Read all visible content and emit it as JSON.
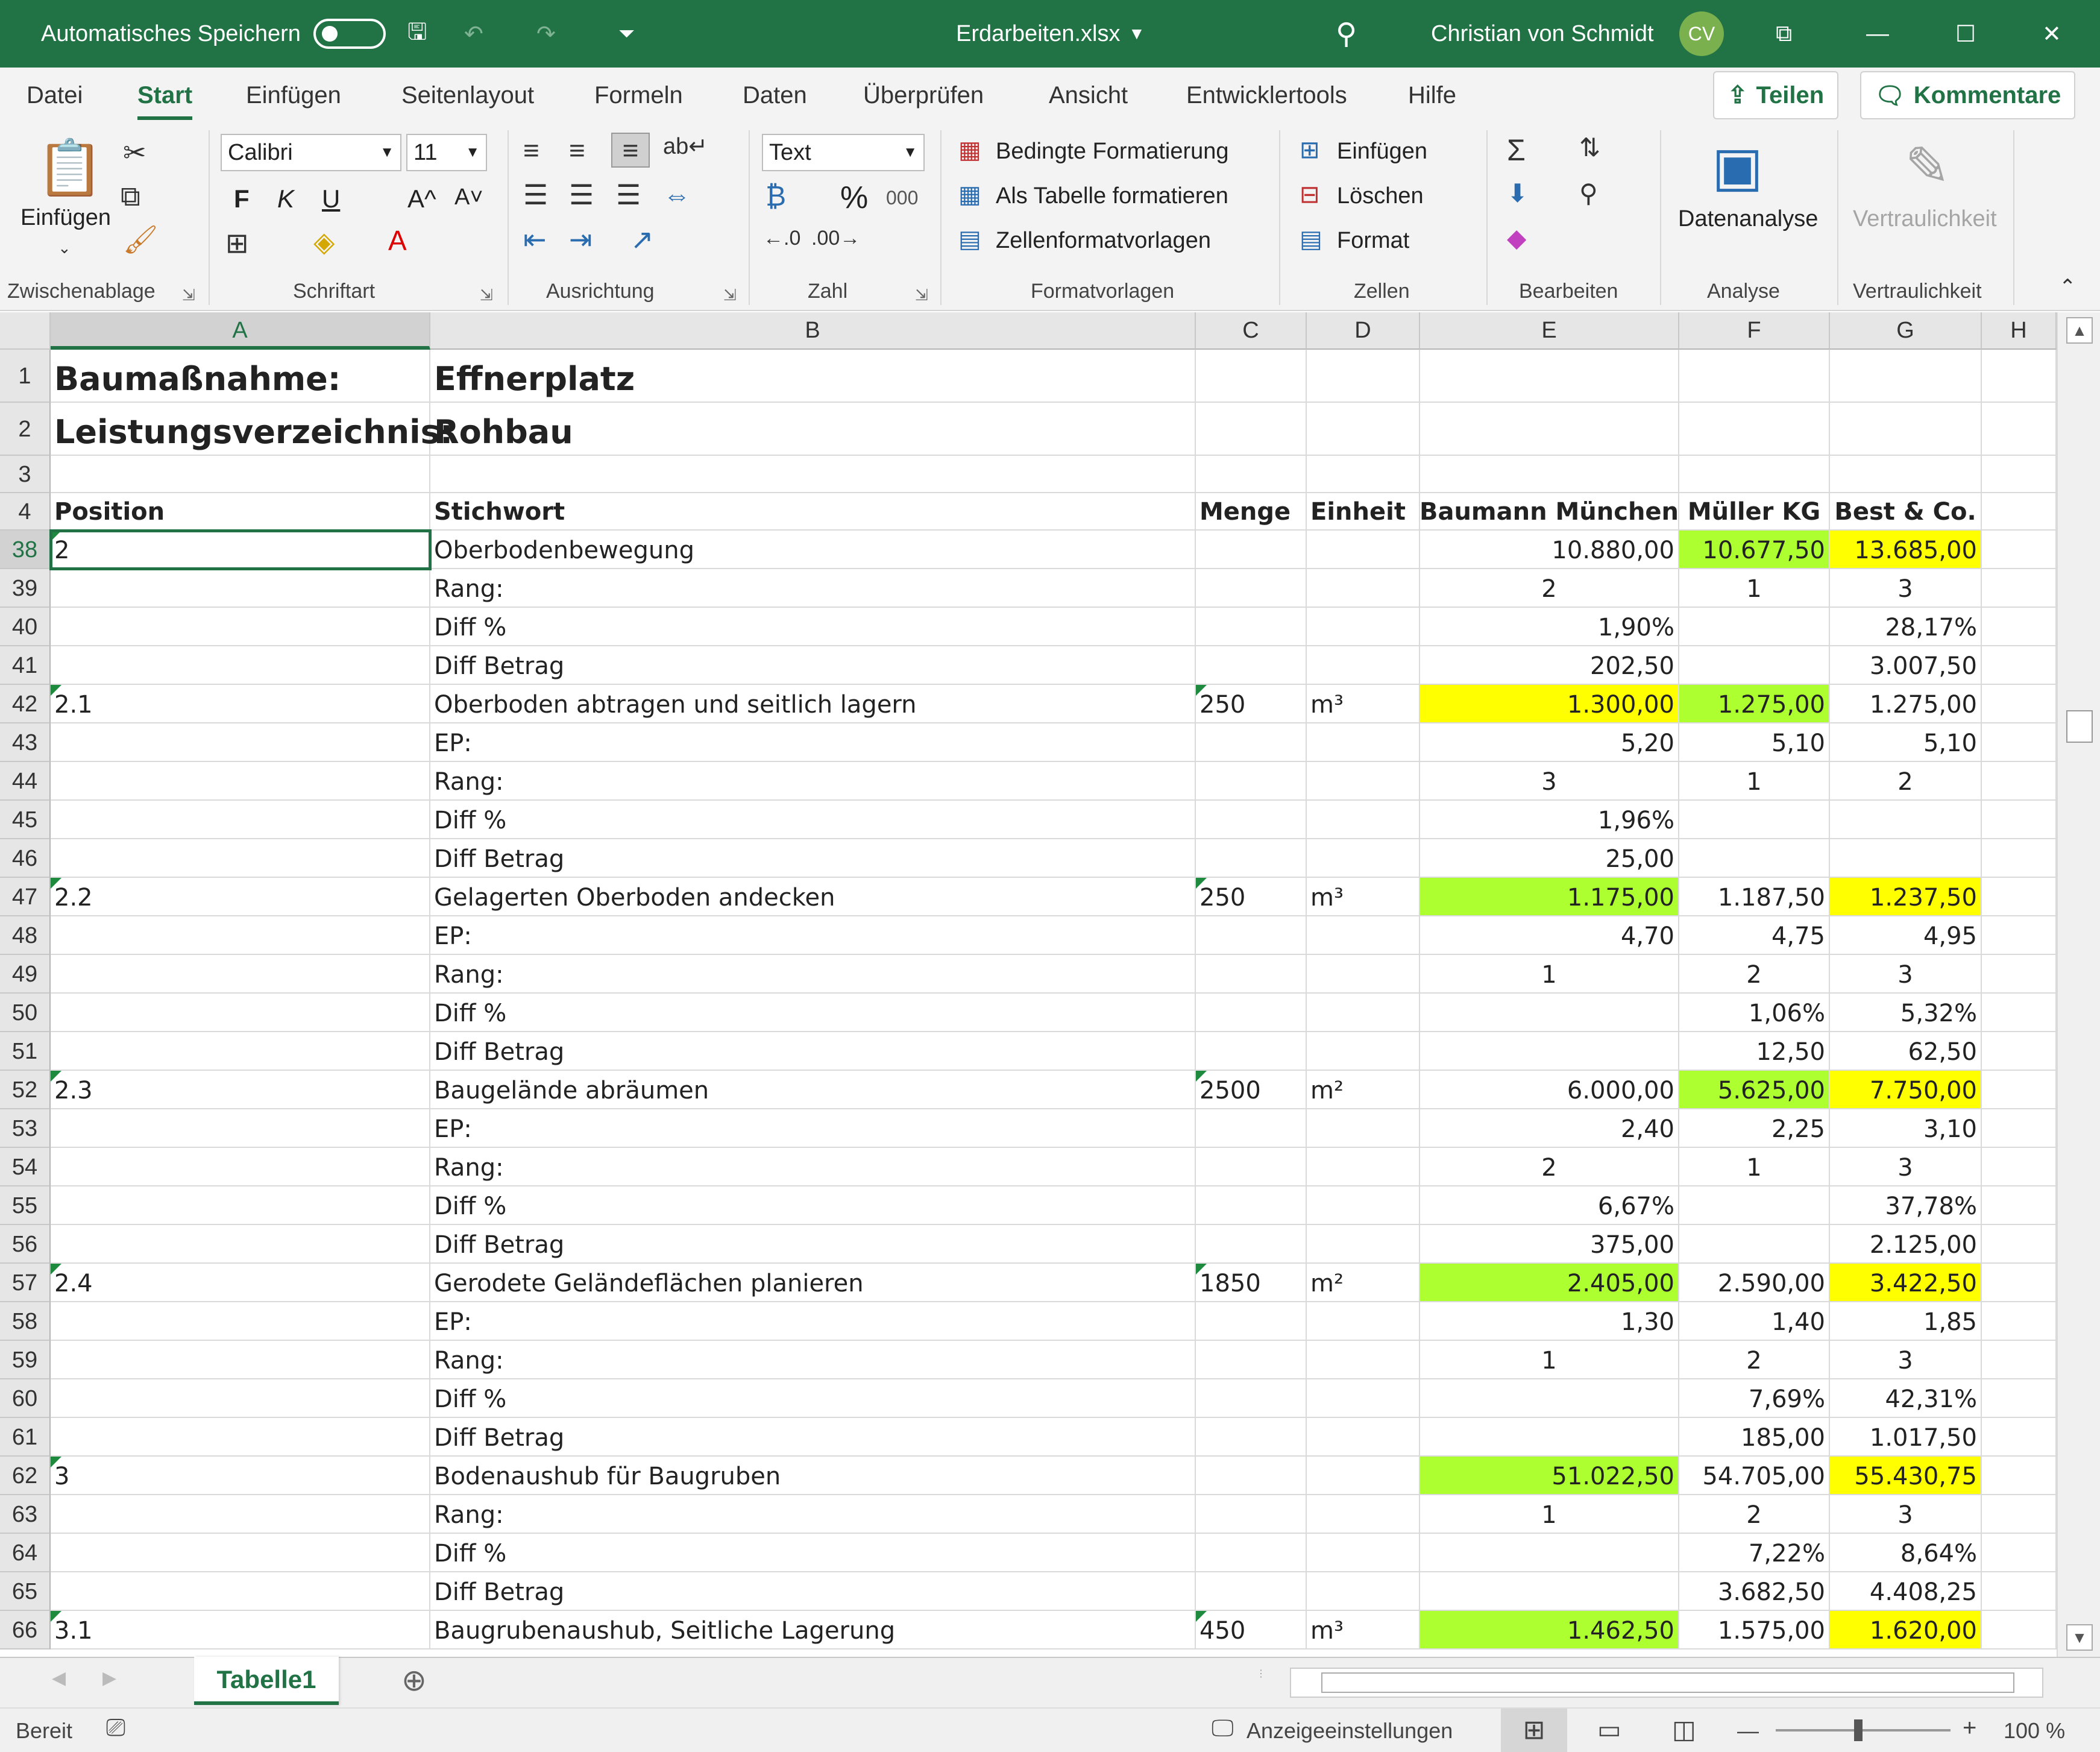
{
  "titlebar": {
    "autosave_label": "Automatisches Speichern",
    "filename": "Erdarbeiten.xlsx",
    "user_name": "Christian von Schmidt",
    "user_initials": "CV"
  },
  "ribbon_tabs": [
    "Datei",
    "Start",
    "Einfügen",
    "Seitenlayout",
    "Formeln",
    "Daten",
    "Überprüfen",
    "Ansicht",
    "Entwicklertools",
    "Hilfe"
  ],
  "active_tab": "Start",
  "share_label": "Teilen",
  "comments_label": "Kommentare",
  "ribbon": {
    "clipboard": {
      "paste_label": "Einfügen",
      "group_label": "Zwischenablage"
    },
    "font": {
      "font_name": "Calibri",
      "font_size": "11",
      "bold": "F",
      "italic": "K",
      "underline": "U",
      "grow": "A^",
      "shrink": "A˅",
      "group_label": "Schriftart"
    },
    "alignment": {
      "group_label": "Ausrichtung"
    },
    "number": {
      "format": "Text",
      "percent": "%",
      "thousands": "000",
      "group_label": "Zahl"
    },
    "styles": {
      "conditional": "Bedingte Formatierung",
      "as_table": "Als Tabelle formatieren",
      "cell_styles": "Zellenformatvorlagen",
      "group_label": "Formatvorlagen"
    },
    "cells": {
      "insert": "Einfügen",
      "delete": "Löschen",
      "format": "Format",
      "group_label": "Zellen"
    },
    "editing": {
      "group_label": "Bearbeiten"
    },
    "analysis": {
      "data_analysis": "Datenanalyse",
      "group_label": "Analyse"
    },
    "sensitivity": {
      "label": "Vertraulichkeit",
      "group_label": "Vertraulichkeit"
    }
  },
  "columns": [
    "A",
    "B",
    "C",
    "D",
    "E",
    "F",
    "G",
    "H"
  ],
  "rows": [
    {
      "n": "1",
      "a": "Baumaßnahme:",
      "b": "Effnerplatz",
      "c": "",
      "d": "",
      "e": "",
      "f": "",
      "g": ""
    },
    {
      "n": "2",
      "a": "Leistungsverzeichnis:",
      "b": "Rohbau",
      "c": "",
      "d": "",
      "e": "",
      "f": "",
      "g": ""
    },
    {
      "n": "3",
      "a": "",
      "b": "",
      "c": "",
      "d": "",
      "e": "",
      "f": "",
      "g": ""
    },
    {
      "n": "4",
      "a": "Position",
      "b": "Stichwort",
      "c": "Menge",
      "d": "Einheit",
      "e": "Baumann München",
      "f": "Müller KG",
      "g": "Best & Co."
    },
    {
      "n": "38",
      "a": "2",
      "b": "Oberbodenbewegung",
      "c": "",
      "d": "",
      "e": "10.880,00",
      "f": "10.677,50",
      "g": "13.685,00",
      "fill_f": "green",
      "fill_g": "yellow"
    },
    {
      "n": "39",
      "a": "",
      "b": "Rang:",
      "c": "",
      "d": "",
      "e": "2",
      "f": "1",
      "g": "3"
    },
    {
      "n": "40",
      "a": "",
      "b": "Diff %",
      "c": "",
      "d": "",
      "e": "1,90%",
      "f": "",
      "g": "28,17%"
    },
    {
      "n": "41",
      "a": "",
      "b": "Diff Betrag",
      "c": "",
      "d": "",
      "e": "202,50",
      "f": "",
      "g": "3.007,50"
    },
    {
      "n": "42",
      "a": "2.1",
      "b": "Oberboden abtragen und seitlich lagern",
      "c": "250",
      "d": "m³",
      "e": "1.300,00",
      "f": "1.275,00",
      "g": "1.275,00",
      "fill_e": "yellow",
      "fill_f": "green"
    },
    {
      "n": "43",
      "a": "",
      "b": "EP:",
      "c": "",
      "d": "",
      "e": "5,20",
      "f": "5,10",
      "g": "5,10"
    },
    {
      "n": "44",
      "a": "",
      "b": "Rang:",
      "c": "",
      "d": "",
      "e": "3",
      "f": "1",
      "g": "2"
    },
    {
      "n": "45",
      "a": "",
      "b": "Diff %",
      "c": "",
      "d": "",
      "e": "1,96%",
      "f": "",
      "g": ""
    },
    {
      "n": "46",
      "a": "",
      "b": "Diff Betrag",
      "c": "",
      "d": "",
      "e": "25,00",
      "f": "",
      "g": ""
    },
    {
      "n": "47",
      "a": "2.2",
      "b": "Gelagerten Oberboden andecken",
      "c": "250",
      "d": "m³",
      "e": "1.175,00",
      "f": "1.187,50",
      "g": "1.237,50",
      "fill_e": "green",
      "fill_g": "yellow"
    },
    {
      "n": "48",
      "a": "",
      "b": "EP:",
      "c": "",
      "d": "",
      "e": "4,70",
      "f": "4,75",
      "g": "4,95"
    },
    {
      "n": "49",
      "a": "",
      "b": "Rang:",
      "c": "",
      "d": "",
      "e": "1",
      "f": "2",
      "g": "3"
    },
    {
      "n": "50",
      "a": "",
      "b": "Diff %",
      "c": "",
      "d": "",
      "e": "",
      "f": "1,06%",
      "g": "5,32%"
    },
    {
      "n": "51",
      "a": "",
      "b": "Diff Betrag",
      "c": "",
      "d": "",
      "e": "",
      "f": "12,50",
      "g": "62,50"
    },
    {
      "n": "52",
      "a": "2.3",
      "b": "Baugelände abräumen",
      "c": "2500",
      "d": "m²",
      "e": "6.000,00",
      "f": "5.625,00",
      "g": "7.750,00",
      "fill_f": "green",
      "fill_g": "yellow"
    },
    {
      "n": "53",
      "a": "",
      "b": "EP:",
      "c": "",
      "d": "",
      "e": "2,40",
      "f": "2,25",
      "g": "3,10"
    },
    {
      "n": "54",
      "a": "",
      "b": "Rang:",
      "c": "",
      "d": "",
      "e": "2",
      "f": "1",
      "g": "3"
    },
    {
      "n": "55",
      "a": "",
      "b": "Diff %",
      "c": "",
      "d": "",
      "e": "6,67%",
      "f": "",
      "g": "37,78%"
    },
    {
      "n": "56",
      "a": "",
      "b": "Diff Betrag",
      "c": "",
      "d": "",
      "e": "375,00",
      "f": "",
      "g": "2.125,00"
    },
    {
      "n": "57",
      "a": "2.4",
      "b": "Gerodete Geländeflächen planieren",
      "c": "1850",
      "d": "m²",
      "e": "2.405,00",
      "f": "2.590,00",
      "g": "3.422,50",
      "fill_e": "green",
      "fill_g": "yellow"
    },
    {
      "n": "58",
      "a": "",
      "b": "EP:",
      "c": "",
      "d": "",
      "e": "1,30",
      "f": "1,40",
      "g": "1,85"
    },
    {
      "n": "59",
      "a": "",
      "b": "Rang:",
      "c": "",
      "d": "",
      "e": "1",
      "f": "2",
      "g": "3"
    },
    {
      "n": "60",
      "a": "",
      "b": "Diff %",
      "c": "",
      "d": "",
      "e": "",
      "f": "7,69%",
      "g": "42,31%"
    },
    {
      "n": "61",
      "a": "",
      "b": "Diff Betrag",
      "c": "",
      "d": "",
      "e": "",
      "f": "185,00",
      "g": "1.017,50"
    },
    {
      "n": "62",
      "a": "3",
      "b": "Bodenaushub für Baugruben",
      "c": "",
      "d": "",
      "e": "51.022,50",
      "f": "54.705,00",
      "g": "55.430,75",
      "fill_e": "green",
      "fill_g": "yellow"
    },
    {
      "n": "63",
      "a": "",
      "b": "Rang:",
      "c": "",
      "d": "",
      "e": "1",
      "f": "2",
      "g": "3"
    },
    {
      "n": "64",
      "a": "",
      "b": "Diff %",
      "c": "",
      "d": "",
      "e": "",
      "f": "7,22%",
      "g": "8,64%"
    },
    {
      "n": "65",
      "a": "",
      "b": "Diff Betrag",
      "c": "",
      "d": "",
      "e": "",
      "f": "3.682,50",
      "g": "4.408,25"
    },
    {
      "n": "66",
      "a": "3.1",
      "b": "Baugrubenaushub, Seitliche Lagerung",
      "c": "450",
      "d": "m³",
      "e": "1.462,50",
      "f": "1.575,00",
      "g": "1.620,00",
      "fill_e": "green",
      "fill_g": "yellow"
    }
  ],
  "colors": {
    "excel_green": "#217346",
    "cell_green": "#adff2f",
    "cell_yellow": "#ffff00"
  },
  "sheet_tab": "Tabelle1",
  "status": {
    "ready": "Bereit",
    "display_settings": "Anzeigeeinstellungen",
    "zoom": "100 %"
  }
}
